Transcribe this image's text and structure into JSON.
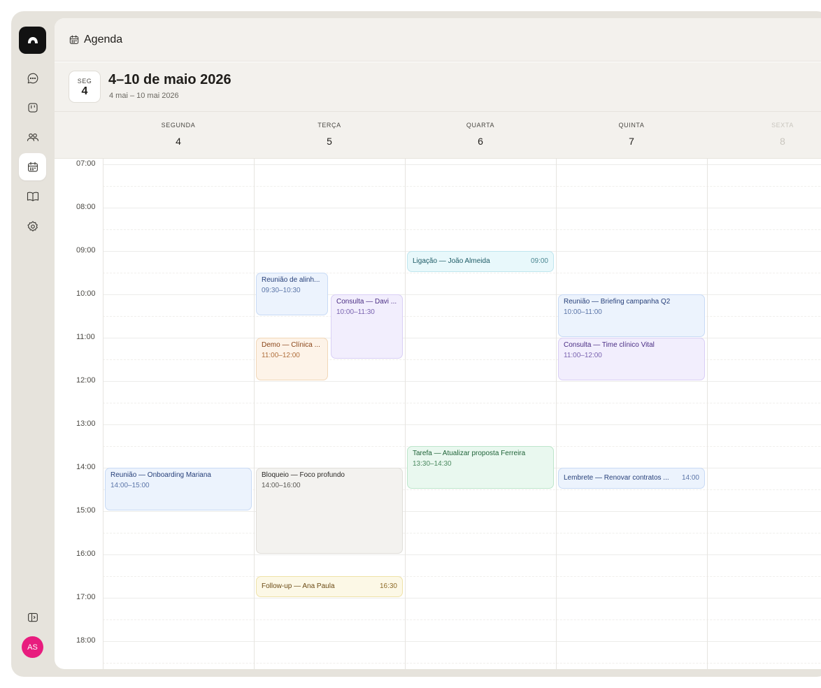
{
  "header": {
    "title": "Agenda",
    "icon": "calendar-icon"
  },
  "week": {
    "day_abbr": "SEG",
    "day_num": "4",
    "title": "4–10 de maio 2026",
    "subtitle": "4 mai – 10 mai 2026"
  },
  "days": [
    {
      "name": "SEGUNDA",
      "num": "4"
    },
    {
      "name": "TERÇA",
      "num": "5"
    },
    {
      "name": "QUARTA",
      "num": "6"
    },
    {
      "name": "QUINTA",
      "num": "7"
    },
    {
      "name": "SEXTA",
      "num": "8"
    }
  ],
  "hours": [
    "07:00",
    "08:00",
    "09:00",
    "10:00",
    "11:00",
    "12:00",
    "13:00",
    "14:00",
    "15:00",
    "16:00",
    "17:00",
    "18:00"
  ],
  "events": [
    {
      "title": "Ligação — João Almeida",
      "time": "09:00",
      "day": 2,
      "start": "09:00",
      "end": "09:30",
      "color": "cyan"
    },
    {
      "title": "Reunião de alinh...",
      "time": "09:30–10:30",
      "day": 1,
      "start": "09:30",
      "end": "10:30",
      "color": "blue"
    },
    {
      "title": "Consulta — Davi ...",
      "time": "10:00–11:30",
      "day": 1,
      "start": "10:00",
      "end": "11:30",
      "color": "purple"
    },
    {
      "title": "Reunião — Briefing campanha Q2",
      "time": "10:00–11:00",
      "day": 3,
      "start": "10:00",
      "end": "11:00",
      "color": "blue"
    },
    {
      "title": "Demo — Clínica ...",
      "time": "11:00–12:00",
      "day": 1,
      "start": "11:00",
      "end": "12:00",
      "color": "orange"
    },
    {
      "title": "Consulta — Time clínico Vital",
      "time": "11:00–12:00",
      "day": 3,
      "start": "11:00",
      "end": "12:00",
      "color": "purple"
    },
    {
      "title": "Tarefa — Atualizar proposta Ferreira",
      "time": "13:30–14:30",
      "day": 2,
      "start": "13:30",
      "end": "14:30",
      "color": "green"
    },
    {
      "title": "Reunião — Onboarding Mariana",
      "time": "14:00–15:00",
      "day": 0,
      "start": "14:00",
      "end": "15:00",
      "color": "blue"
    },
    {
      "title": "Bloqueio — Foco profundo",
      "time": "14:00–16:00",
      "day": 1,
      "start": "14:00",
      "end": "16:00",
      "color": "gray"
    },
    {
      "title": "Lembrete — Renovar contratos ...",
      "time": "14:00",
      "day": 3,
      "start": "14:00",
      "end": "14:30",
      "color": "blue"
    },
    {
      "title": "Follow-up — Ana Paula",
      "time": "16:30",
      "day": 1,
      "start": "16:30",
      "end": "17:00",
      "color": "yellow"
    }
  ],
  "user": {
    "initials": "AS"
  },
  "colors": {
    "accent": "#e81c7e",
    "logo_bg": "#121212"
  }
}
